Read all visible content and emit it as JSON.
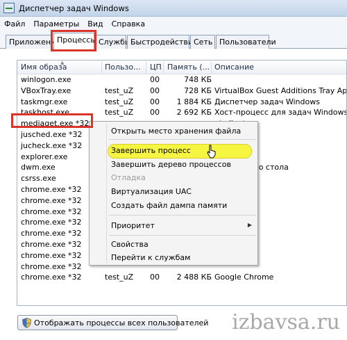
{
  "window": {
    "title": "Диспетчер задач Windows"
  },
  "menu": [
    "Файл",
    "Параметры",
    "Вид",
    "Справка"
  ],
  "tabs": [
    "Приложения",
    "Процессы",
    "Службы",
    "Быстродействие",
    "Сеть",
    "Пользователи"
  ],
  "active_tab": "Процессы",
  "columns": [
    "Имя образа",
    "Пользо...",
    "ЦП",
    "Память (...",
    "Описание"
  ],
  "rows": [
    {
      "name": "winlogon.exe",
      "user": "",
      "cpu": "00",
      "mem": "748 КБ",
      "desc": ""
    },
    {
      "name": "VBoxTray.exe",
      "user": "test_uZ",
      "cpu": "00",
      "mem": "728 КБ",
      "desc": "VirtualBox Guest Additions Tray Application"
    },
    {
      "name": "taskmgr.exe",
      "user": "test_uZ",
      "cpu": "00",
      "mem": "1 884 КБ",
      "desc": "Диспетчер задач Windows"
    },
    {
      "name": "taskhost.exe",
      "user": "test_uZ",
      "cpu": "00",
      "mem": "2 692 КБ",
      "desc": "Хост-процесс для задач Windows"
    },
    {
      "name": "mediaget.exe *32",
      "user": "",
      "cpu": "",
      "mem": "",
      "desc": "nt client"
    },
    {
      "name": "jusched.exe *32",
      "user": "",
      "cpu": "",
      "mem": "",
      "desc": "cheduler"
    },
    {
      "name": "jucheck.exe *32",
      "user": "",
      "cpu": "",
      "mem": "",
      "desc": "hecker"
    },
    {
      "name": "explorer.exe",
      "user": "",
      "cpu": "",
      "mem": "",
      "desc": ""
    },
    {
      "name": "dwm.exe",
      "user": "",
      "cpu": "",
      "mem": "",
      "desc": "он рабочего стола"
    },
    {
      "name": "csrss.exe",
      "user": "",
      "cpu": "",
      "mem": "",
      "desc": ""
    },
    {
      "name": "chrome.exe *32",
      "user": "",
      "cpu": "",
      "mem": "",
      "desc": ""
    },
    {
      "name": "chrome.exe *32",
      "user": "",
      "cpu": "",
      "mem": "",
      "desc": ""
    },
    {
      "name": "chrome.exe *32",
      "user": "",
      "cpu": "",
      "mem": "",
      "desc": ""
    },
    {
      "name": "chrome.exe *32",
      "user": "",
      "cpu": "",
      "mem": "",
      "desc": ""
    },
    {
      "name": "chrome.exe *32",
      "user": "",
      "cpu": "",
      "mem": "",
      "desc": ""
    },
    {
      "name": "chrome.exe *32",
      "user": "",
      "cpu": "",
      "mem": "",
      "desc": ""
    },
    {
      "name": "chrome.exe *32",
      "user": "",
      "cpu": "",
      "mem": "",
      "desc": ""
    },
    {
      "name": "chrome.exe *32",
      "user": "",
      "cpu": "",
      "mem": "",
      "desc": ""
    },
    {
      "name": "chrome.exe *32",
      "user": "test_uZ",
      "cpu": "00",
      "mem": "2 488 КБ",
      "desc": "Google Chrome"
    }
  ],
  "context_menu": {
    "items": [
      {
        "label": "Открыть место хранения файла"
      },
      {
        "label": "Завершить процесс",
        "selected": true
      },
      {
        "label": "Завершить дерево процессов"
      },
      {
        "label": "Отладка",
        "disabled": true
      },
      {
        "label": "Виртуализация UAC"
      },
      {
        "label": "Создать файл дампа памяти"
      },
      {
        "label": "Приоритет",
        "submenu": true
      },
      {
        "label": "Свойства"
      },
      {
        "label": "Перейти к службам"
      }
    ]
  },
  "footer": {
    "show_all_button": "Отображать процессы всех пользователей"
  },
  "watermark": "izbavsa.ru",
  "colors": {
    "highlight_border": "#d9352b",
    "menu_selection": "#f6f542"
  },
  "icons": [
    "taskmgr-app-icon",
    "uac-shield-icon",
    "mouse-pointer-icon",
    "submenu-arrow-icon"
  ]
}
